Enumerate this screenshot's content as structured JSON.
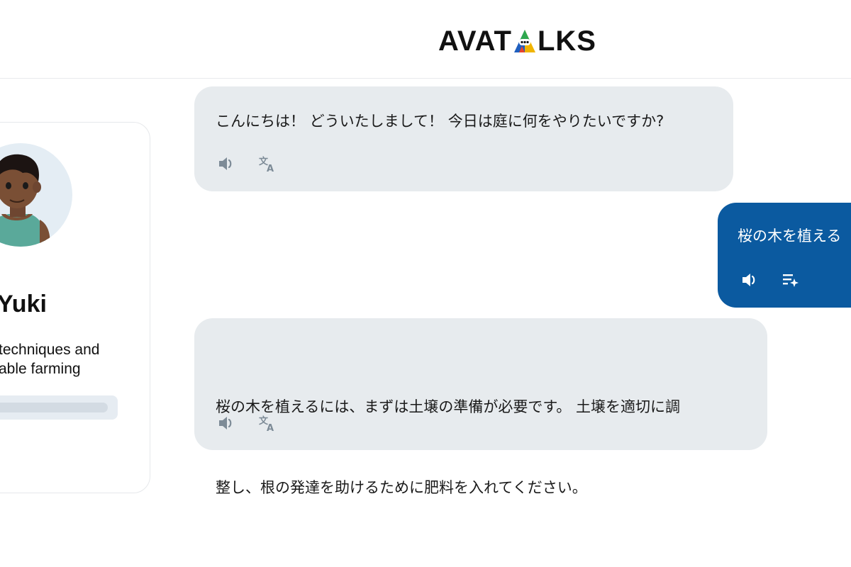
{
  "header": {
    "logo_left": "AVAT",
    "logo_right": "LKS",
    "logo_full": "AVATALKS"
  },
  "profile": {
    "name": "Yuki",
    "description_line1": "techniques and",
    "description_line2": "able farming",
    "progress": 0.1,
    "progress_color": "#0d5ea6"
  },
  "messages": [
    {
      "role": "assistant",
      "text": "こんにちは！ どういたしまして！ 今日は庭に何をやりたいですか?",
      "actions": [
        "speaker-icon",
        "translate-icon"
      ]
    },
    {
      "role": "user",
      "text": "桜の木を植える",
      "actions": [
        "speaker-icon",
        "text-sparkle-icon"
      ]
    },
    {
      "role": "assistant",
      "text_line1": "桜の木を植えるには、まずは土壌の準備が必要です。 土壌を適切に調",
      "text_line2": "整し、根の発達を助けるために肥料を入れてください。",
      "actions": [
        "speaker-icon",
        "translate-icon"
      ]
    }
  ],
  "colors": {
    "bot_bubble": "#e7ebee",
    "user_bubble": "#0b5aa0",
    "icon_gray": "#7d8b97"
  }
}
